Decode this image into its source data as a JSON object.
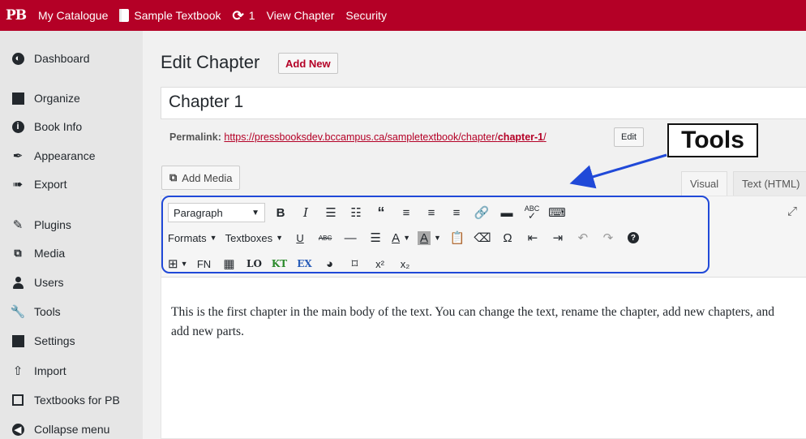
{
  "adminbar": {
    "logo": "PB",
    "my_catalogue": "My Catalogue",
    "book_title": "Sample Textbook",
    "sync_count": "1",
    "view_chapter": "View Chapter",
    "security": "Security"
  },
  "sidebar": {
    "items": [
      {
        "label": "Dashboard",
        "icon": "dashboard-icon"
      },
      {
        "label": "Organize",
        "icon": "book-icon"
      },
      {
        "label": "Book Info",
        "icon": "info-icon"
      },
      {
        "label": "Appearance",
        "icon": "brush-icon"
      },
      {
        "label": "Export",
        "icon": "export-icon"
      },
      {
        "label": "Plugins",
        "icon": "plugin-icon"
      },
      {
        "label": "Media",
        "icon": "media-icon"
      },
      {
        "label": "Users",
        "icon": "users-icon"
      },
      {
        "label": "Tools",
        "icon": "wrench-icon"
      },
      {
        "label": "Settings",
        "icon": "settings-icon"
      },
      {
        "label": "Import",
        "icon": "import-icon"
      },
      {
        "label": "Textbooks for PB",
        "icon": "textbooks-icon"
      },
      {
        "label": "Collapse menu",
        "icon": "collapse-icon"
      }
    ]
  },
  "main": {
    "page_title": "Edit Chapter",
    "add_new": "Add New",
    "title_value": "Chapter 1",
    "permalink_label": "Permalink:",
    "permalink_base": "https://pressbooksdev.bccampus.ca/sampletextbook/chapter/",
    "permalink_slug": "chapter-1",
    "permalink_trailing": "/",
    "edit": "Edit",
    "add_media": "Add Media",
    "tab_visual": "Visual",
    "tab_text": "Text (HTML)"
  },
  "toolbar": {
    "paragraph": "Paragraph",
    "formats": "Formats",
    "textboxes": "Textboxes",
    "fn": "FN",
    "lo": "LO",
    "kt": "KT",
    "ex": "EX",
    "abc": "ABC",
    "bold": "B",
    "italic": "I",
    "underline": "U",
    "text_color": "A",
    "bg_color": "A"
  },
  "content": {
    "body": "This is the first chapter in the main body of the text. You can change the text, rename the chapter, add new chapters, and add new parts."
  },
  "annotation": {
    "label": "Tools",
    "color": "#2049d8"
  },
  "colors": {
    "brand": "#b40026",
    "sidebar_bg": "#e6e6e6"
  }
}
